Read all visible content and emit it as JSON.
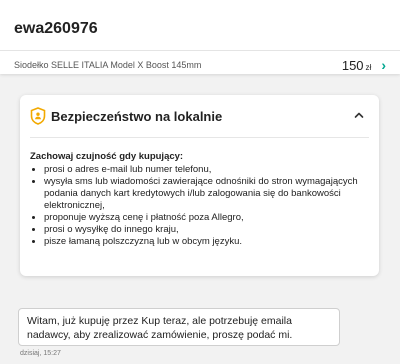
{
  "header": {
    "username": "ewa260976",
    "product_name": "Siodełko SELLE ITALIA Model X Boost 145mm",
    "price": "150",
    "currency": "zł",
    "chevron_icon": "chevron-right-icon"
  },
  "safety_card": {
    "icon": "shield-icon",
    "title": "Bezpieczeństwo na lokalnie",
    "collapse_icon": "chevron-up-icon",
    "lead": "Zachowaj czujność gdy kupujący:",
    "items": [
      "prosi o adres e-mail lub numer telefonu,",
      "wysyła sms lub wiadomości zawierające odnośniki do stron wymagających podania danych kart kredytowych i/lub zalogowania się do bankowości elektronicznej,",
      "proponuje wyższą cenę i płatność poza Allegro,",
      "prosi o wysyłkę do innego kraju,",
      "pisze łamaną polszczyzną lub w obcym języku."
    ]
  },
  "message": {
    "text": "Witam, już kupuję przez Kup teraz, ale potrzebuję emaila nadawcy, aby zrealizować zamówienie, proszę podać mi.",
    "timestamp": "dzisiaj, 15:27"
  },
  "colors": {
    "accent": "#00a790",
    "shield": "#f2a900",
    "background": "#f2f2f2"
  }
}
